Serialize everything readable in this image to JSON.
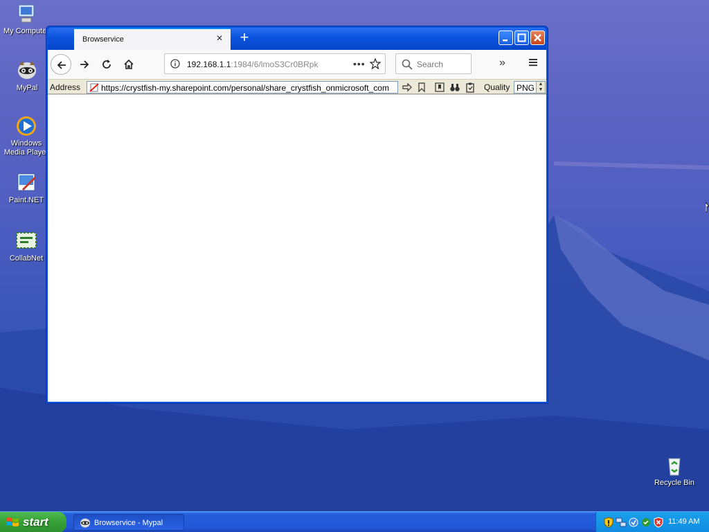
{
  "desktop": {
    "icons": [
      {
        "label": "My Computer",
        "icon": "my-computer-icon"
      },
      {
        "label": "MyPal",
        "icon": "mypal-icon"
      },
      {
        "label": "Windows Media Player",
        "icon": "media-player-icon"
      },
      {
        "label": "Paint.NET",
        "icon": "paint-net-icon"
      },
      {
        "label": "CollabNet",
        "icon": "collabnet-icon"
      },
      {
        "label": "Recycle Bin",
        "icon": "recycle-bin-icon"
      }
    ]
  },
  "browser": {
    "tab_title": "Browservice",
    "url_host": "192.168.1.1",
    "url_rest": ":1984/6/lmoS3Cr0BRpk",
    "search_placeholder": "Search",
    "address_label": "Address",
    "address_url": "https://crystfish-my.sharepoint.com/personal/share_crystfish_onmicrosoft_com",
    "quality_label": "Quality",
    "quality_value": "PNG"
  },
  "taskbar": {
    "start_label": "start",
    "task_label": "Browservice - Mypal",
    "clock": "11:49 AM"
  },
  "colors": {
    "title_blue": "#0a52d8",
    "taskbar_blue": "#245edb",
    "start_green": "#35a135",
    "tray_blue": "#0f8be0"
  }
}
